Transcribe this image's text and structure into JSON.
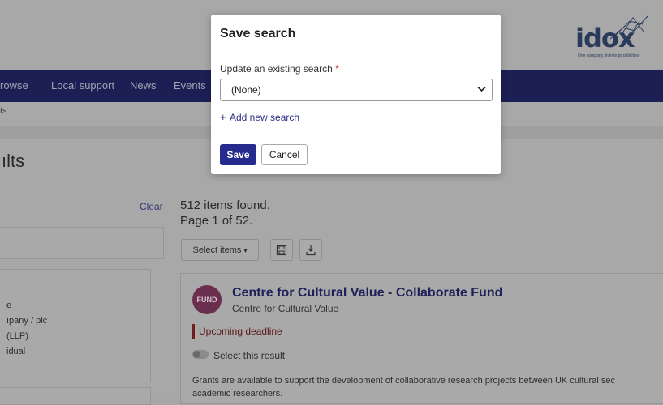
{
  "header": {
    "logo_text": "idox",
    "logo_tagline": "One company. Infinite possibilities"
  },
  "nav": {
    "items": [
      "rowse",
      "Local support",
      "News",
      "Events"
    ]
  },
  "breadcrumb": "ts",
  "page_title": "ılts",
  "filters": {
    "clear_label": "Clear",
    "options": [
      "e",
      "ıpany / plc",
      "(LLP)",
      "idual"
    ]
  },
  "results": {
    "found_text": "512 items found.",
    "page_text": "Page 1 of 52.",
    "select_items_label": "Select items",
    "card": {
      "badge": "FUND",
      "title": "Centre for Cultural Value - Collaborate Fund",
      "subtitle": "Centre for Cultural Value",
      "deadline": "Upcoming deadline",
      "select_label": "Select this result",
      "description": "Grants are available to support the development of collaborative research projects between UK cultural sec",
      "description_cont": "academic researchers."
    }
  },
  "modal": {
    "title": "Save search",
    "field_label": "Update an existing search",
    "required_mark": "*",
    "select_value": "(None)",
    "add_plus": "+",
    "add_link": "Add new search",
    "save_label": "Save",
    "cancel_label": "Cancel"
  },
  "colors": {
    "navbar": "#1c1f54",
    "primary_button": "#272b8d",
    "fund_badge": "#6a2e4f",
    "deadline": "#6d1f1f"
  }
}
